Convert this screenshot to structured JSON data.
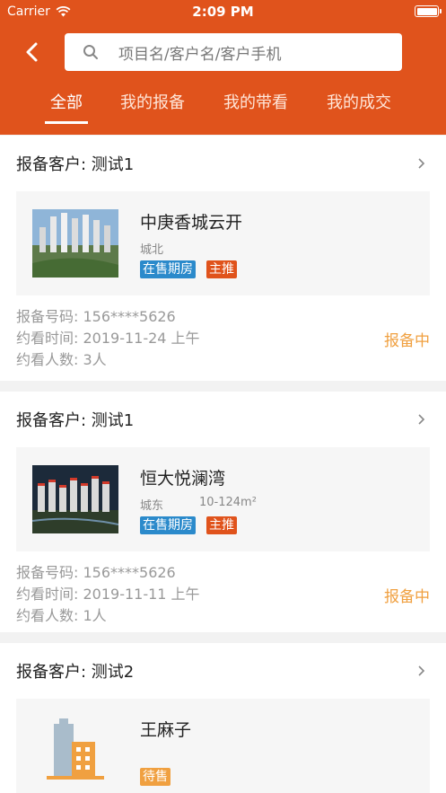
{
  "status_bar": {
    "carrier": "Carrier",
    "time": "2:09 PM"
  },
  "search": {
    "placeholder": "项目名/客户名/客户手机"
  },
  "tabs": [
    {
      "label": "全部"
    },
    {
      "label": "我的报备"
    },
    {
      "label": "我的带看"
    },
    {
      "label": "我的成交"
    }
  ],
  "colors": {
    "brand": "#e0531c",
    "tag_blue": "#2b8acb",
    "status_orange": "#f0a040"
  },
  "records": [
    {
      "customer": "报备客户: 测试1",
      "project": {
        "name": "中庚香城云开",
        "district": "城北",
        "area": "",
        "tags": [
          "在售期房",
          "主推"
        ]
      },
      "phone": "报备号码: 156****5626",
      "visit_time": "约看时间: 2019-11-24 上午",
      "visitors": "约看人数: 3人",
      "status": "报备中"
    },
    {
      "customer": "报备客户: 测试1",
      "project": {
        "name": "恒大悦澜湾",
        "district": "城东",
        "area": "10-124m²",
        "tags": [
          "在售期房",
          "主推"
        ]
      },
      "phone": "报备号码: 156****5626",
      "visit_time": "约看时间: 2019-11-11 上午",
      "visitors": "约看人数: 1人",
      "status": "报备中"
    },
    {
      "customer": "报备客户: 测试2",
      "project": {
        "name": "王麻子",
        "district": "",
        "area": "",
        "tags": [
          "待售"
        ]
      }
    }
  ]
}
